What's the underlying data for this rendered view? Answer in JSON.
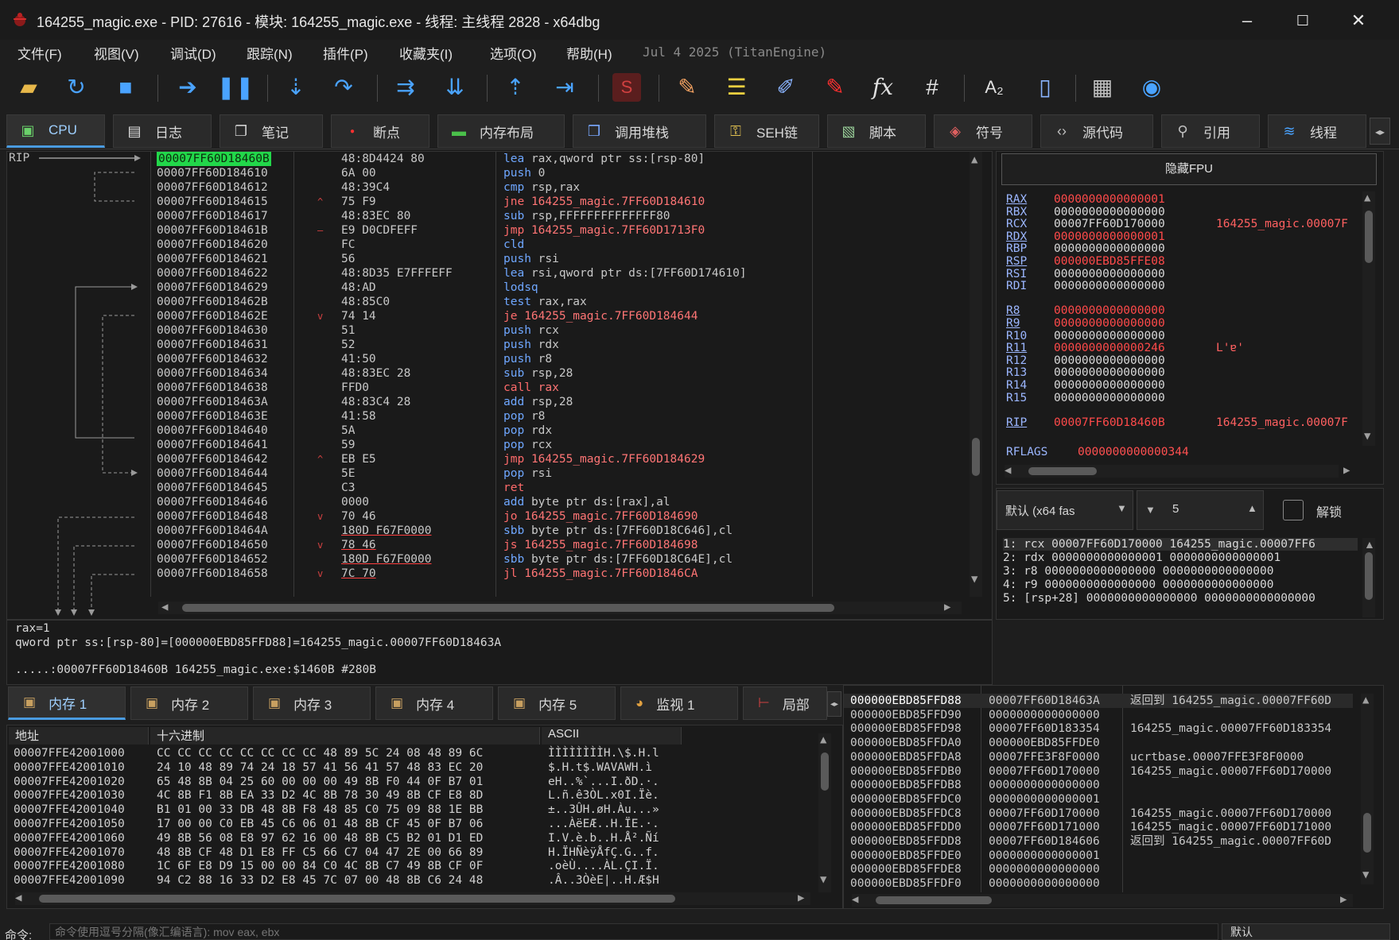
{
  "window": {
    "title": "164255_magic.exe - PID: 27616 - 模块: 164255_magic.exe - 线程: 主线程 2828 - x64dbg"
  },
  "menu": {
    "items": [
      "文件(F)",
      "视图(V)",
      "调试(D)",
      "跟踪(N)",
      "插件(P)",
      "收藏夹(I)",
      "选项(O)",
      "帮助(H)"
    ],
    "info": "Jul 4 2025 (TitanEngine)"
  },
  "toolbar": {
    "icons": [
      "open-folder-icon",
      "restart-icon",
      "stop-icon",
      "run-icon",
      "pause-icon",
      "step-into-icon",
      "step-over-icon",
      "trace-into-icon",
      "trace-over-icon",
      "execute-till-return-icon",
      "run-to-user-code-icon",
      "scylla-icon",
      "patch-icon",
      "memory-map-icon",
      "label-icon",
      "breakpoint-icon",
      "function-icon",
      "hash-icon",
      "font-icon",
      "calculator-icon",
      "device-icon",
      "web-icon"
    ]
  },
  "tabs": [
    {
      "label": "CPU",
      "icon": "cpu-icon",
      "active": true
    },
    {
      "label": "日志",
      "icon": "log-icon"
    },
    {
      "label": "笔记",
      "icon": "notes-icon"
    },
    {
      "label": "断点",
      "icon": "breakpoint-icon"
    },
    {
      "label": "内存布局",
      "icon": "memory-map-icon"
    },
    {
      "label": "调用堆栈",
      "icon": "call-stack-icon"
    },
    {
      "label": "SEH链",
      "icon": "seh-icon"
    },
    {
      "label": "脚本",
      "icon": "script-icon"
    },
    {
      "label": "符号",
      "icon": "symbols-icon"
    },
    {
      "label": "源代码",
      "icon": "source-icon"
    },
    {
      "label": "引用",
      "icon": "references-icon"
    },
    {
      "label": "线程",
      "icon": "threads-icon"
    }
  ],
  "disasm": {
    "rip_label": "RIP",
    "rows": [
      {
        "addr": "00007FF60D18460B",
        "bytes": "48:8D4424 80",
        "mn": "lea",
        "ops": "rax,qword ptr ss:[rsp-80]",
        "sel": true
      },
      {
        "addr": "00007FF60D184610",
        "bytes": "6A 00",
        "mn": "push",
        "ops": "0"
      },
      {
        "addr": "00007FF60D184612",
        "bytes": "48:39C4",
        "mn": "cmp",
        "ops": "rsp,rax"
      },
      {
        "addr": "00007FF60D184615",
        "bytes": "75 F9",
        "mn": "jne",
        "ops": "164255_magic.7FF60D184610",
        "jmp": true,
        "mark": "^"
      },
      {
        "addr": "00007FF60D184617",
        "bytes": "48:83EC 80",
        "mn": "sub",
        "ops": "rsp,FFFFFFFFFFFFFF80"
      },
      {
        "addr": "00007FF60D18461B",
        "bytes": "E9 D0CDFEFF",
        "mn": "jmp",
        "ops": "164255_magic.7FF60D1713F0",
        "jmp": true,
        "mark": "—"
      },
      {
        "addr": "00007FF60D184620",
        "bytes": "FC",
        "mn": "cld",
        "ops": ""
      },
      {
        "addr": "00007FF60D184621",
        "bytes": "56",
        "mn": "push",
        "ops": "rsi"
      },
      {
        "addr": "00007FF60D184622",
        "bytes": "48:8D35 E7FFFEFF",
        "mn": "lea",
        "ops": "rsi,qword ptr ds:[7FF60D174610]"
      },
      {
        "addr": "00007FF60D184629",
        "bytes": "48:AD",
        "mn": "lodsq",
        "ops": ""
      },
      {
        "addr": "00007FF60D18462B",
        "bytes": "48:85C0",
        "mn": "test",
        "ops": "rax,rax"
      },
      {
        "addr": "00007FF60D18462E",
        "bytes": "74 14",
        "mn": "je",
        "ops": "164255_magic.7FF60D184644",
        "jmp": true,
        "mark": "v"
      },
      {
        "addr": "00007FF60D184630",
        "bytes": "51",
        "mn": "push",
        "ops": "rcx"
      },
      {
        "addr": "00007FF60D184631",
        "bytes": "52",
        "mn": "push",
        "ops": "rdx"
      },
      {
        "addr": "00007FF60D184632",
        "bytes": "41:50",
        "mn": "push",
        "ops": "r8"
      },
      {
        "addr": "00007FF60D184634",
        "bytes": "48:83EC 28",
        "mn": "sub",
        "ops": "rsp,28"
      },
      {
        "addr": "00007FF60D184638",
        "bytes": "FFD0",
        "mn": "call",
        "ops": "rax",
        "jmp": true
      },
      {
        "addr": "00007FF60D18463A",
        "bytes": "48:83C4 28",
        "mn": "add",
        "ops": "rsp,28"
      },
      {
        "addr": "00007FF60D18463E",
        "bytes": "41:58",
        "mn": "pop",
        "ops": "r8"
      },
      {
        "addr": "00007FF60D184640",
        "bytes": "5A",
        "mn": "pop",
        "ops": "rdx"
      },
      {
        "addr": "00007FF60D184641",
        "bytes": "59",
        "mn": "pop",
        "ops": "rcx"
      },
      {
        "addr": "00007FF60D184642",
        "bytes": "EB E5",
        "mn": "jmp",
        "ops": "164255_magic.7FF60D184629",
        "jmp": true,
        "mark": "^"
      },
      {
        "addr": "00007FF60D184644",
        "bytes": "5E",
        "mn": "pop",
        "ops": "rsi"
      },
      {
        "addr": "00007FF60D184645",
        "bytes": "C3",
        "mn": "ret",
        "ops": "",
        "jmp": true
      },
      {
        "addr": "00007FF60D184646",
        "bytes": "0000",
        "mn": "add",
        "ops": "byte ptr ds:[rax],al"
      },
      {
        "addr": "00007FF60D184648",
        "bytes": "70 46",
        "mn": "jo",
        "ops": "164255_magic.7FF60D184690",
        "jmp": true,
        "mark": "v"
      },
      {
        "addr": "00007FF60D18464A",
        "bytes": "180D F67F0000",
        "mn": "sbb",
        "ops": "byte ptr ds:[7FF60D18C646],cl",
        "ul": true
      },
      {
        "addr": "00007FF60D184650",
        "bytes": "78 46",
        "mn": "js",
        "ops": "164255_magic.7FF60D184698",
        "jmp": true,
        "mark": "v",
        "ul": true
      },
      {
        "addr": "00007FF60D184652",
        "bytes": "180D F67F0000",
        "mn": "sbb",
        "ops": "byte ptr ds:[7FF60D18C64E],cl",
        "ul": true
      },
      {
        "addr": "00007FF60D184658",
        "bytes": "7C 70",
        "mn": "jl",
        "ops": "164255_magic.7FF60D1846CA",
        "jmp": true,
        "mark": "v",
        "ul": true
      }
    ]
  },
  "registers": {
    "fpu_button": "隐藏FPU",
    "rows": [
      {
        "name": "RAX",
        "value": "0000000000000001",
        "changed": true
      },
      {
        "name": "RBX",
        "value": "0000000000000000"
      },
      {
        "name": "RCX",
        "value": "00007FF60D170000",
        "comment": "164255_magic.00007F"
      },
      {
        "name": "RDX",
        "value": "0000000000000001",
        "changed": true
      },
      {
        "name": "RBP",
        "value": "0000000000000000"
      },
      {
        "name": "RSP",
        "value": "000000EBD85FFE08",
        "changed": true
      },
      {
        "name": "RSI",
        "value": "0000000000000000"
      },
      {
        "name": "RDI",
        "value": "0000000000000000"
      },
      {
        "name": "",
        "value": ""
      },
      {
        "name": "R8",
        "value": "0000000000000000",
        "changed": true
      },
      {
        "name": "R9",
        "value": "0000000000000000",
        "changed": true
      },
      {
        "name": "R10",
        "value": "0000000000000000"
      },
      {
        "name": "R11",
        "value": "0000000000000246",
        "changed": true,
        "comment": "L'ɐ'"
      },
      {
        "name": "R12",
        "value": "0000000000000000"
      },
      {
        "name": "R13",
        "value": "0000000000000000"
      },
      {
        "name": "R14",
        "value": "0000000000000000"
      },
      {
        "name": "R15",
        "value": "0000000000000000"
      },
      {
        "name": "",
        "value": ""
      },
      {
        "name": "RIP",
        "value": "00007FF60D18460B",
        "changed": true,
        "comment": "164255_magic.00007F"
      }
    ],
    "rflags_name": "RFLAGS",
    "rflags_value": "0000000000000344"
  },
  "callconv": {
    "convention": "默认 (x64 fas",
    "arg_count": "5",
    "unlock_label": "解锁",
    "rows": [
      "1: rcx 00007FF60D170000 164255_magic.00007FF6",
      "2: rdx 0000000000000001 0000000000000001",
      "3: r8 0000000000000000 0000000000000000",
      "4: r9 0000000000000000 0000000000000000",
      "5: [rsp+28] 0000000000000000 0000000000000000"
    ]
  },
  "info": {
    "line1": "rax=1",
    "line2": "qword ptr ss:[rsp-80]=[000000EBD85FFD88]=164255_magic.00007FF60D18463A",
    "line3": ".....:00007FF60D18460B 164255_magic.exe:$1460B #280B"
  },
  "bottom_tabs": [
    {
      "label": "内存 1",
      "active": true
    },
    {
      "label": "内存 2"
    },
    {
      "label": "内存 3"
    },
    {
      "label": "内存 4"
    },
    {
      "label": "内存 5"
    },
    {
      "label": "监视 1"
    },
    {
      "label": "局部"
    }
  ],
  "dump": {
    "headers": {
      "addr": "地址",
      "hex": "十六进制",
      "ascii": "ASCII"
    },
    "rows": [
      {
        "addr": "00007FFE42001000",
        "hex": "CC CC CC CC CC CC CC CC 48 89 5C 24 08 48 89 6C",
        "ascii": "ÌÌÌÌÌÌÌÌH.\\$.H.l"
      },
      {
        "addr": "00007FFE42001010",
        "hex": "24 10 48 89 74 24 18 57 41 56 41 57 48 83 EC 20",
        "ascii": "$.H.t$.WAVAWH.ì "
      },
      {
        "addr": "00007FFE42001020",
        "hex": "65 48 8B 04 25 60 00 00 00 49 8B F0 44 0F B7 01",
        "ascii": "eH..%`...I.ðD.·."
      },
      {
        "addr": "00007FFE42001030",
        "hex": "4C 8B F1 8B EA 33 D2 4C 8B 78 30 49 8B CF E8 8D",
        "ascii": "L.ñ.ê3ÒL.x0I.Ïè."
      },
      {
        "addr": "00007FFE42001040",
        "hex": "B1 01 00 33 DB 48 8B F8 48 85 C0 75 09 88 1E BB",
        "ascii": "±..3ÛH.øH.Àu...»"
      },
      {
        "addr": "00007FFE42001050",
        "hex": "17 00 00 C0 EB 45 C6 06 01 48 8B CF 45 0F B7 06",
        "ascii": "...ÀëEÆ..H.ÏE.·."
      },
      {
        "addr": "00007FFE42001060",
        "hex": "49 8B 56 08 E8 97 62 16 00 48 8B C5 B2 01 D1 ED",
        "ascii": "I.V.è.b..H.Å².Ñí"
      },
      {
        "addr": "00007FFE42001070",
        "hex": "48 8B CF 48 D1 E8 FF C5 66 C7 04 47 2E 00 66 89",
        "ascii": "H.ÏHÑèÿÅfÇ.G..f."
      },
      {
        "addr": "00007FFE42001080",
        "hex": "1C 6F E8 D9 15 00 00 84 C0 4C 8B C7 49 8B CF 0F",
        "ascii": ".oèÙ....ÀL.ÇI.Ï."
      },
      {
        "addr": "00007FFE42001090",
        "hex": "94 C2 88 16 33 D2 E8 45 7C 07 00 48 8B C6 24 48",
        "ascii": ".Â..3ÒèE|..H.Æ$H"
      }
    ]
  },
  "stack": {
    "rows": [
      {
        "addr": "000000EBD85FFD88",
        "val": "00007FF60D18463A",
        "cmt": "返回到 164255_magic.00007FF60D",
        "sel": true
      },
      {
        "addr": "000000EBD85FFD90",
        "val": "0000000000000000",
        "cmt": ""
      },
      {
        "addr": "000000EBD85FFD98",
        "val": "00007FF60D183354",
        "cmt": "164255_magic.00007FF60D183354"
      },
      {
        "addr": "000000EBD85FFDA0",
        "val": "000000EBD85FFDE0",
        "cmt": ""
      },
      {
        "addr": "000000EBD85FFDA8",
        "val": "00007FFE3F8F0000",
        "cmt": "ucrtbase.00007FFE3F8F0000"
      },
      {
        "addr": "000000EBD85FFDB0",
        "val": "00007FF60D170000",
        "cmt": "164255_magic.00007FF60D170000"
      },
      {
        "addr": "000000EBD85FFDB8",
        "val": "0000000000000000",
        "cmt": ""
      },
      {
        "addr": "000000EBD85FFDC0",
        "val": "0000000000000001",
        "cmt": ""
      },
      {
        "addr": "000000EBD85FFDC8",
        "val": "00007FF60D170000",
        "cmt": "164255_magic.00007FF60D170000"
      },
      {
        "addr": "000000EBD85FFDD0",
        "val": "00007FF60D171000",
        "cmt": "164255_magic.00007FF60D171000"
      },
      {
        "addr": "000000EBD85FFDD8",
        "val": "00007FF60D184606",
        "cmt": "返回到 164255_magic.00007FF60D"
      },
      {
        "addr": "000000EBD85FFDE0",
        "val": "0000000000000001",
        "cmt": ""
      },
      {
        "addr": "000000EBD85FFDE8",
        "val": "0000000000000000",
        "cmt": ""
      },
      {
        "addr": "000000EBD85FFDF0",
        "val": "0000000000000000",
        "cmt": ""
      }
    ]
  },
  "command": {
    "label": "命令:",
    "placeholder": "命令使用逗号分隔(像汇编语言): mov eax, ebx",
    "mode": "默认"
  },
  "colors": {
    "accent": "#4a9be0",
    "selected_addr": "#22d74a",
    "changed_reg": "#ff4a4a",
    "mnemonic": "#6fa7ff"
  }
}
